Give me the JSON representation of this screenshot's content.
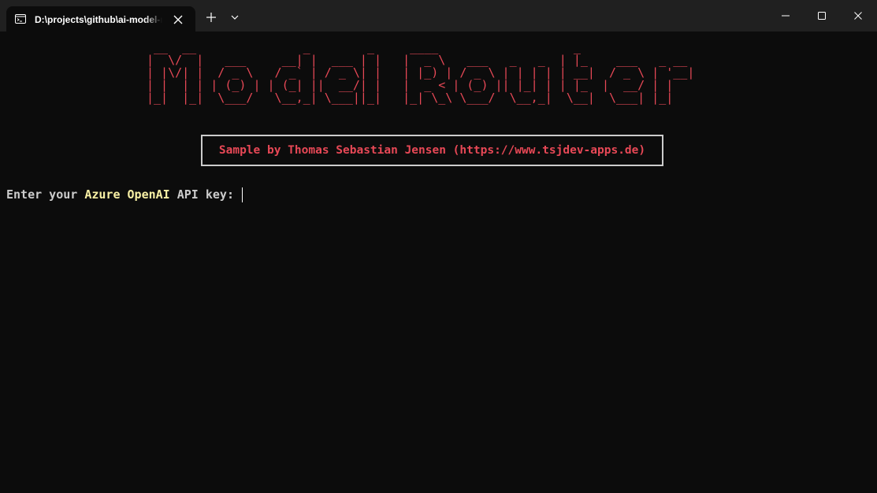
{
  "window": {
    "tab_title": "D:\\projects\\github\\ai-model-r",
    "tab_icon": "terminal-icon",
    "icons": {
      "close_tab": "close-icon",
      "new_tab": "plus-icon",
      "tab_menu": "chevron-down-icon",
      "minimize": "minimize-icon",
      "maximize": "maximize-icon",
      "close_window": "close-icon"
    }
  },
  "terminal": {
    "banner_lines": [
      " __  __               _        _     ____                   _",
      "|  \\/  |   ___     __| |  ___ | |   |  _ \\   ___   _   _  | |_    ___   _ __",
      "| |\\/| |  / _ \\   / _` | / _ \\| |   | |_) | / _ \\ | | | | | __|  / _ \\ | '__|",
      "| |  | | | (_) | | (_| ||  __/| |   |  _ < | (_) || |_| | | |_  |  __/ | |",
      "|_|  |_|  \\___/   \\__,_| \\___||_|   |_| \\_\\ \\___/  \\__,_|  \\__|  \\___| |_|"
    ],
    "credit": "Sample by Thomas Sebastian Jensen (https://www.tsjdev-apps.de)",
    "prompt": {
      "before": "Enter your ",
      "highlight": "Azure OpenAI",
      "after": " API key: "
    }
  },
  "colors": {
    "background": "#0c0c0c",
    "titlebar": "#202020",
    "banner": "#e74856",
    "highlight": "#f9f1a5",
    "text": "#cccccc",
    "box_border": "#cccccc"
  }
}
